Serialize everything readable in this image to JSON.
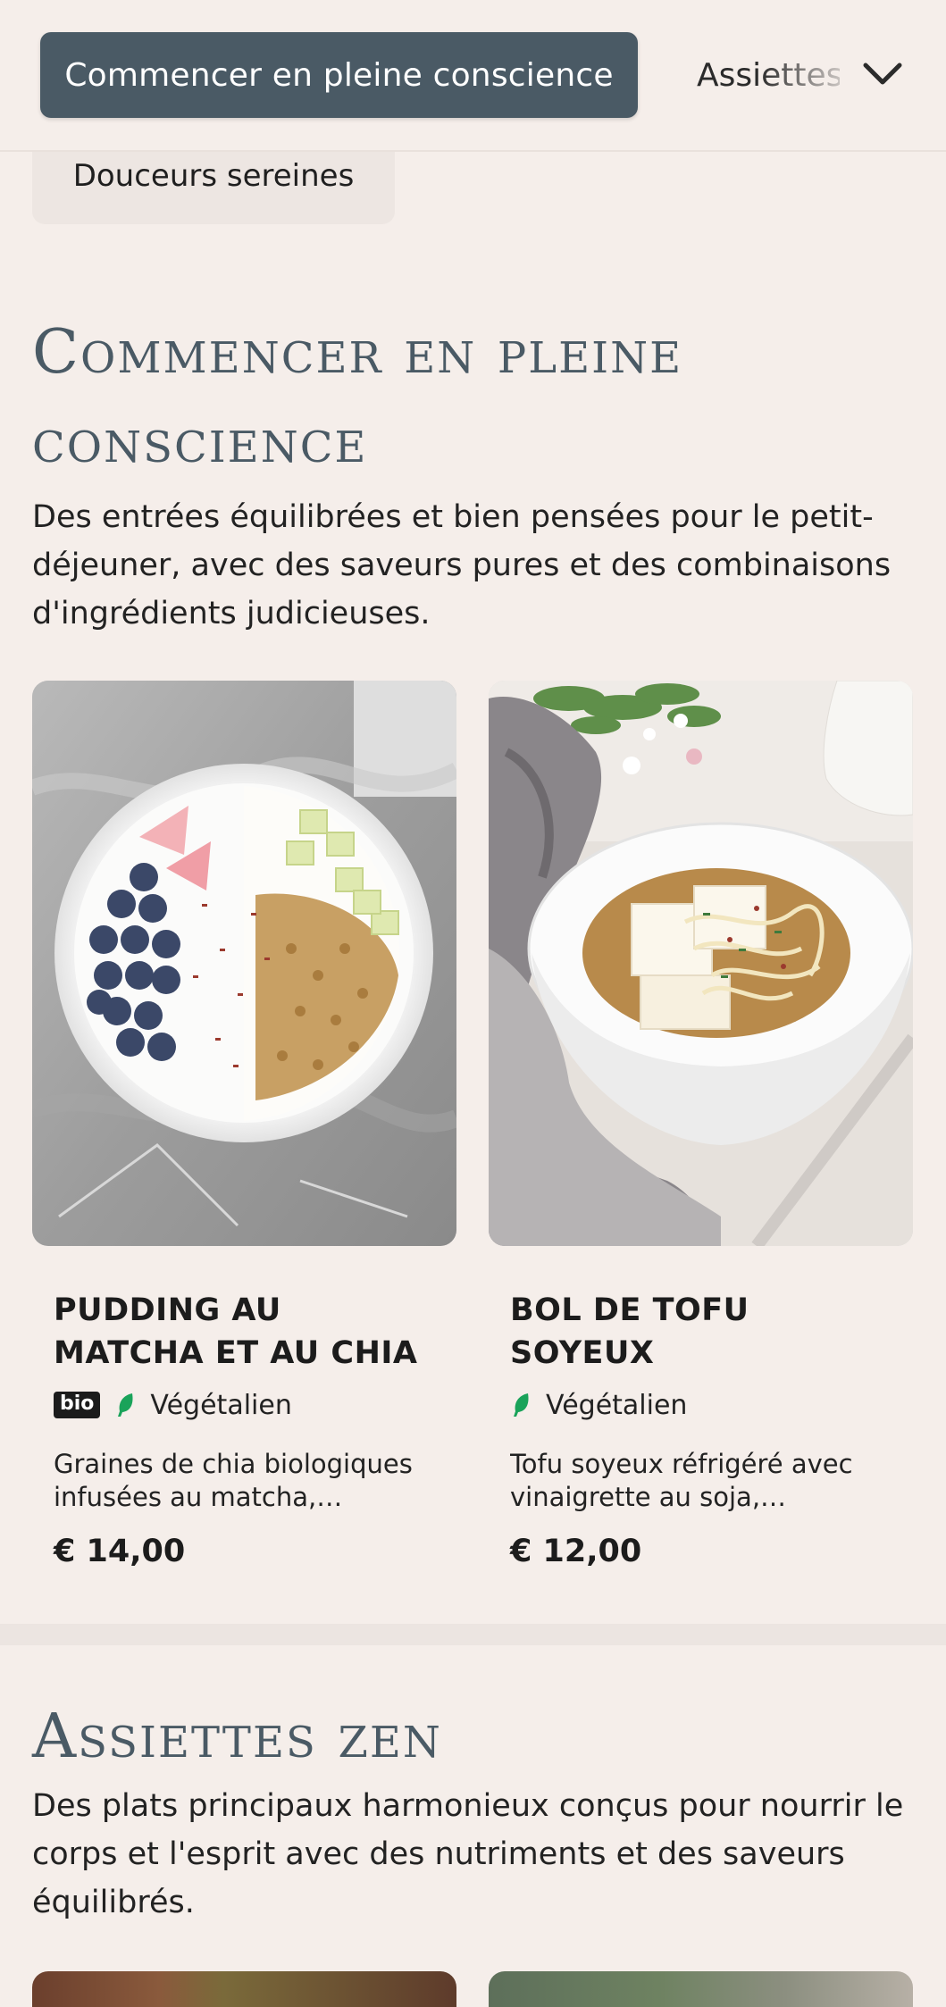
{
  "nav": {
    "active_label": "Commencer en pleine conscience",
    "next_label": "Assiettes zen",
    "previous_label": "Douceurs sereines"
  },
  "sections": [
    {
      "title": "Commencer en pleine conscience",
      "description": "Des entrées équilibrées et bien pensées pour le petit-déjeuner, avec des saveurs pures et des combinaisons d'ingrédients judicieuses.",
      "items": [
        {
          "name": "Pudding au matcha et au chia",
          "badge": "bio",
          "tag": "Végétalien",
          "description": "Graines de chia biologiques infusées au matcha, trempé...",
          "price": "€ 14,00"
        },
        {
          "name": "Bol de tofu soyeux",
          "tag": "Végétalien",
          "description": "Tofu soyeux réfrigéré avec vinaigrette au soja, oignons...",
          "price": "€ 12,00"
        }
      ]
    },
    {
      "title": "Assiettes zen",
      "description": "Des plats principaux harmonieux conçus pour nourrir le corps et l'esprit avec des nutriments et des saveurs équilibrés."
    }
  ],
  "colors": {
    "background": "#f5eeea",
    "accent": "#4a5a65",
    "vegan_leaf": "#1aa35a"
  },
  "icons": {
    "nav_expand": "chevron-down-icon",
    "vegan": "leaf-icon"
  }
}
